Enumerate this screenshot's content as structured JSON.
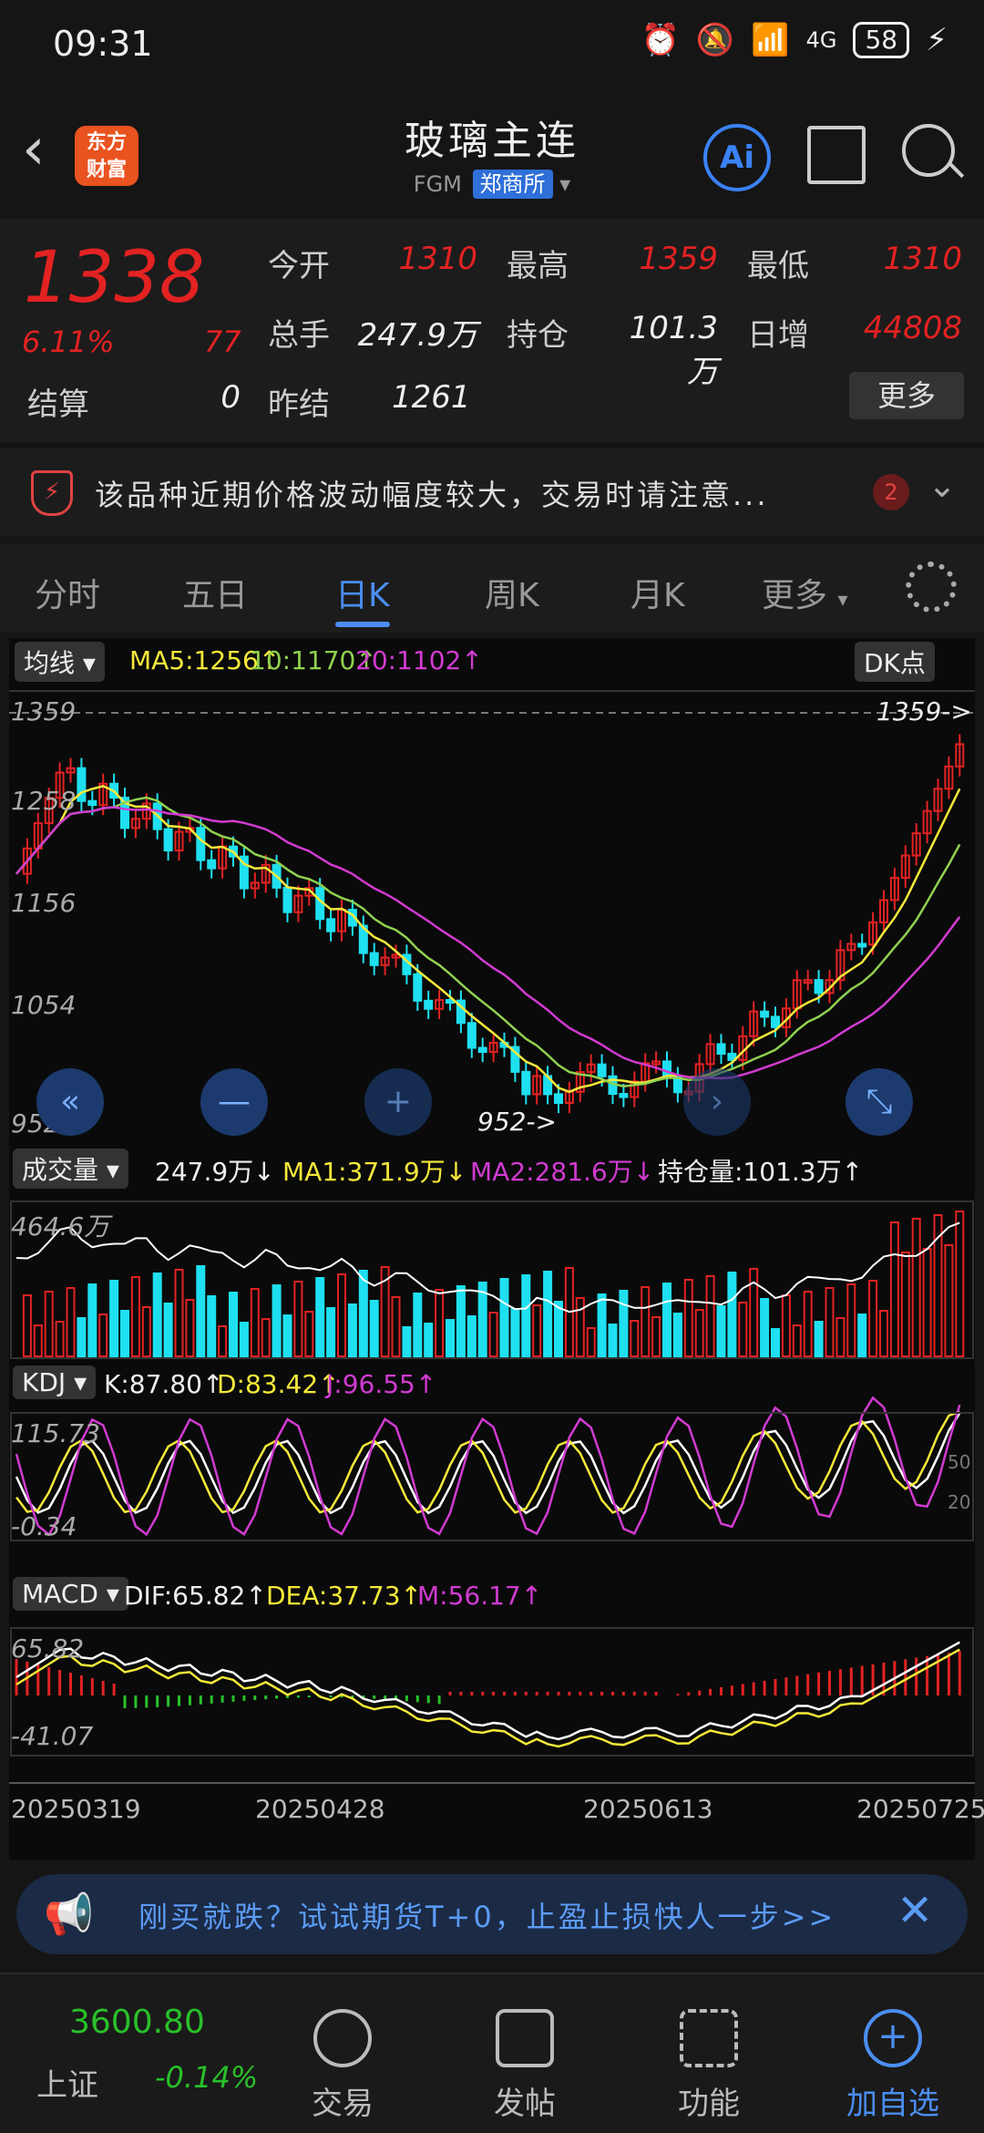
{
  "status_bar": {
    "time": "09:31",
    "battery": "58",
    "net": "4G"
  },
  "header": {
    "title": "玻璃主连",
    "code": "FGM",
    "exchange": "郑商所",
    "logo": "东方\n财富",
    "ai": "Ai"
  },
  "quote": {
    "price": "1338",
    "change_pct": "6.11%",
    "change": "77",
    "rows": [
      [
        {
          "label": "今开",
          "value": "1310",
          "red": true
        },
        {
          "label": "最高",
          "value": "1359",
          "red": true
        },
        {
          "label": "最低",
          "value": "1310",
          "red": true
        }
      ],
      [
        {
          "label": "总手",
          "value": "247.9万",
          "red": false
        },
        {
          "label": "持仓",
          "value": "101.3万",
          "red": false
        },
        {
          "label": "日增",
          "value": "44808",
          "red": true
        }
      ]
    ],
    "settle_label": "结算",
    "settle_value": "0",
    "prev_label": "昨结",
    "prev_value": "1261",
    "more": "更多"
  },
  "notice": {
    "text": "该品种近期价格波动幅度较大，交易时请注意...",
    "count": "2"
  },
  "tabs": {
    "items": [
      "分时",
      "五日",
      "日K",
      "周K",
      "月K",
      "更多"
    ],
    "active": 2
  },
  "chart": {
    "ma_selector": "均线",
    "ma5": "MA5:1256↑",
    "ma10": "10:1170↑",
    "ma20": "20:1102↑",
    "dk": "DK点",
    "y_labels": [
      "1359",
      "1258",
      "1156",
      "1054",
      "952"
    ],
    "high_marker": "1359->",
    "low_marker": "952->",
    "vol_selector": "成交量",
    "vol_value": "247.9万↓",
    "vol_ma1": "MA1:371.9万↓",
    "vol_ma2": "MA2:281.6万↓",
    "oi": "持仓量:101.3万↑",
    "vol_axis": "464.6万",
    "kdj_selector": "KDJ",
    "kdj_k": "K:87.80↑",
    "kdj_d": "D:83.42↑",
    "kdj_j": "J:96.55↑",
    "kdj_top": "115.73",
    "kdj_bottom": "-0.34",
    "kdj_50": "50",
    "kdj_20": "20",
    "macd_selector": "MACD",
    "macd_dif": "DIF:65.82↑",
    "macd_dea": "DEA:37.73↑",
    "macd_m": "M:56.17↑",
    "macd_top": "65.82",
    "macd_bottom": "-41.07",
    "dates": [
      "20250319",
      "20250428",
      "20250613",
      "20250725"
    ],
    "colors": {
      "up": "#e32222",
      "down": "#1fe0f0",
      "ma5": "#f5e93a",
      "ma10": "#8fd14f",
      "ma20": "#d13bd1",
      "white": "#ffffff"
    }
  },
  "ad": {
    "text": "刚买就跌？试试期货T+0，止盈止损快人一步>>"
  },
  "bottom": {
    "index_value": "3600.80",
    "index_name": "上证",
    "index_change": "-0.14%",
    "items": [
      "交易",
      "发帖",
      "功能",
      "加自选"
    ]
  }
}
